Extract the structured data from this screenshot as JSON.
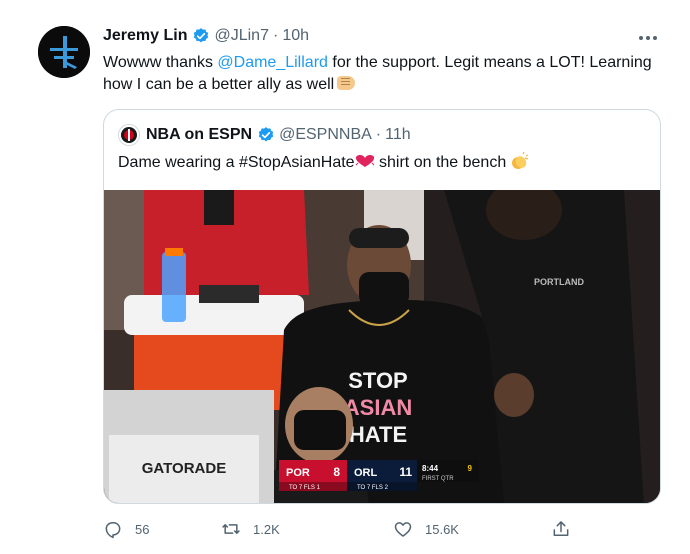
{
  "author": {
    "name": "Jeremy Lin",
    "handle": "@JLin7",
    "separator": "·",
    "time": "10h"
  },
  "tweet": {
    "text_before": "Wowww thanks ",
    "mention": "@Dame_Lillard",
    "text_after": " for the support. Legit means a LOT! Learning how I can be a better ally as well"
  },
  "quoted": {
    "name": "NBA on ESPN",
    "handle": "@ESPNNBA",
    "separator": "·",
    "time": "11h",
    "text_before": "Dame wearing a #StopAsianHate",
    "text_after": " shirt on the bench",
    "photo": {
      "cooler_label": "GATORADE",
      "shirt_lines": [
        "STOP",
        "ASIAN",
        "HATE"
      ],
      "jacket_label": "PORTLAND",
      "scorebug": {
        "home_abbr": "POR",
        "home_score": "8",
        "away_abbr": "ORL",
        "away_score": "11",
        "clock": "8:44",
        "shot_clock": "9",
        "period": "FIRST QTR",
        "home_sub": "TO 7  FLS 1",
        "away_sub": "TO 7  FLS 2"
      }
    }
  },
  "actions": {
    "replies": "56",
    "retweets": "1.2K",
    "likes": "15.6K"
  },
  "colors": {
    "accent": "#1d9bf0",
    "secondary_text": "#536471",
    "border": "#cfd9de"
  }
}
